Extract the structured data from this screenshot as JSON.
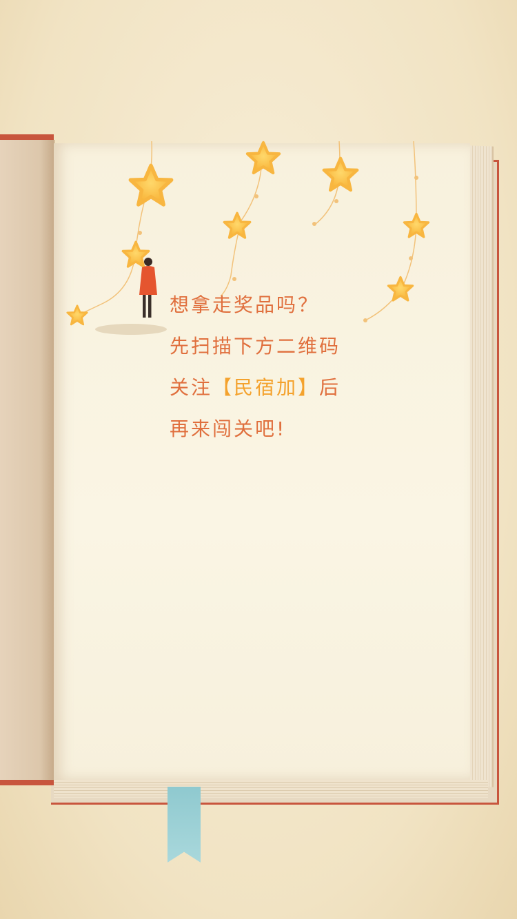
{
  "message": {
    "line1": "想拿走奖品吗？",
    "line2": "先扫描下方二维码",
    "line3_prefix": "关注",
    "line3_brand": "【民宿加】",
    "line3_suffix": "后",
    "line4": "再来闯关吧!"
  },
  "colors": {
    "text": "#e06f3d",
    "brand": "#f4a22d",
    "cover": "#c8553d",
    "bookmark": "#a9d8dc",
    "star": "#ffc24d"
  }
}
